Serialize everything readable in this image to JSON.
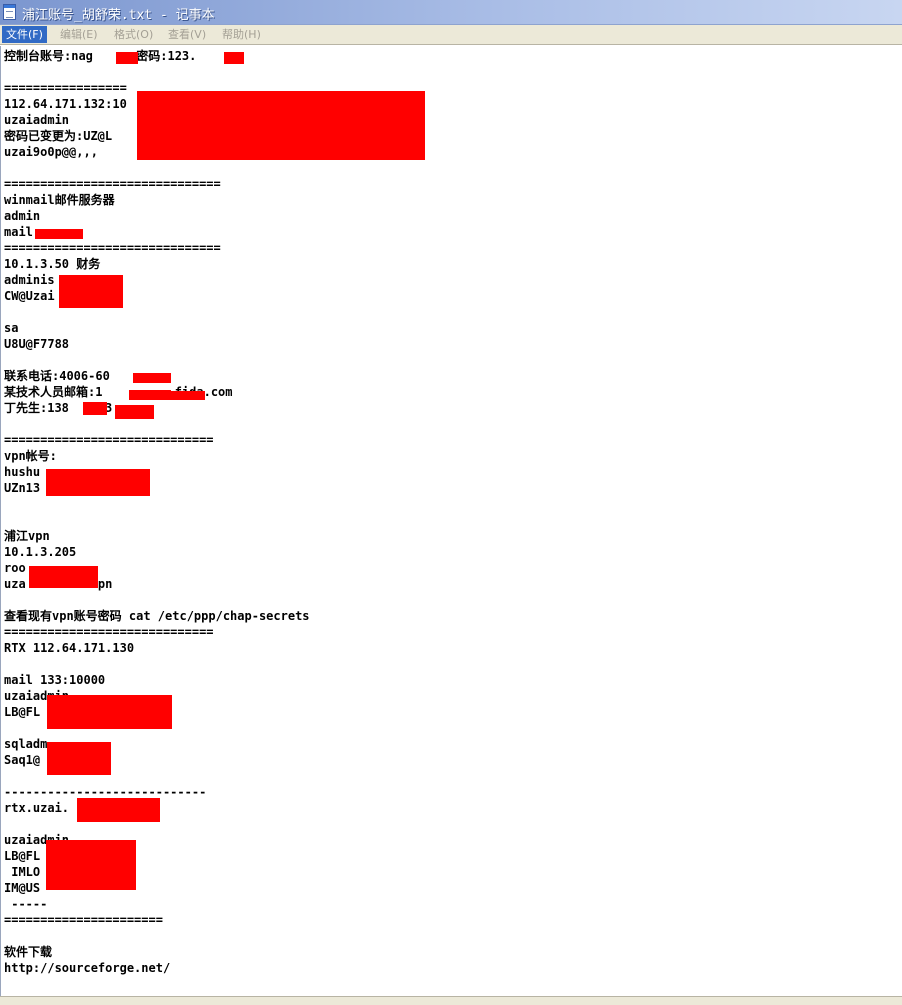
{
  "window": {
    "title": "浦江账号_胡舒荣.txt - 记事本"
  },
  "menu": [
    {
      "label": "文件(F)",
      "active": true
    },
    {
      "label": "编辑(E)",
      "active": false
    },
    {
      "label": "格式(O)",
      "active": false
    },
    {
      "label": "查看(V)",
      "active": false
    },
    {
      "label": "帮助(H)",
      "active": false
    }
  ],
  "lines": [
    "控制台账号:nag      密码:123.    m",
    "",
    "=================",
    "112.64.171.132:10",
    "uzaiadmin",
    "密码已变更为:UZ@L",
    "uzai9o0p@@,,,",
    "",
    "",
    "==============================",
    "winmail邮件服务器",
    "admin",
    "mail",
    "==============================",
    "10.1.3.50 财务",
    "adminis",
    "CW@Uzai",
    "",
    "sa",
    "U8U@F7788",
    "",
    "联系电话:4006-60",
    "某技术人员邮箱:1          fida.com",
    "丁先生:138    23",
    "",
    "=============================",
    "vpn帐号:",
    "hushu",
    "UZn13",
    "",
    "",
    "浦江vpn",
    "10.1.3.205",
    "roo",
    "uza          pn",
    "",
    "查看现有vpn账号密码 cat /etc/ppp/chap-secrets",
    "=============================",
    "RTX 112.64.171.130",
    "",
    "mail 133:10000",
    "uzaiadmin",
    "LB@FL",
    "",
    "sqladm",
    "Saq1@",
    "",
    "----------------------------",
    "rtx.uzai.",
    "",
    "uzaiadmin",
    "LB@FL           9T",
    " IMLO",
    "IM@US",
    " -----",
    "======================",
    "",
    "软件下载",
    "http://sourceforge.net/"
  ]
}
